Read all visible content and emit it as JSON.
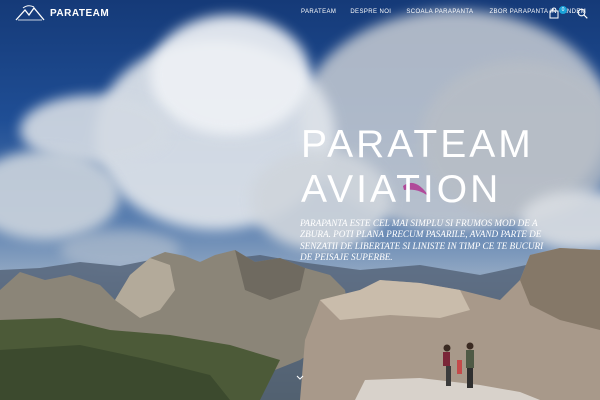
{
  "header": {
    "logo_text": "PARATEAM",
    "logo_icon": "paraglider-mountain-logo",
    "nav": [
      {
        "label": "PARATEAM"
      },
      {
        "label": "DESPRE NOI"
      },
      {
        "label": "SCOALA PARAPANTA"
      },
      {
        "label": "ZBOR PARAPANTA IN TANDEM"
      }
    ],
    "cart_count": "0",
    "cart_icon": "shopping-bag-icon",
    "search_icon": "search-icon"
  },
  "hero": {
    "title_line1": "PARATEAM",
    "title_line2": "AVIATION",
    "subtitle": "PARAPANTA ESTE CEL MAI SIMPLU SI FRUMOS MOD DE A ZBURA. POTI PLANA PRECUM PASARILE, AVAND PARTE DE SENZATII DE LIBERTATE SI LINISTE IN TIMP CE TE BUCURI DE PEISAJE SUPERBE.",
    "scroll_icon": "chevron-down-icon"
  },
  "colors": {
    "accent": "#1aa1d8",
    "text": "#ffffff",
    "paraglider": "#b04a9a"
  }
}
